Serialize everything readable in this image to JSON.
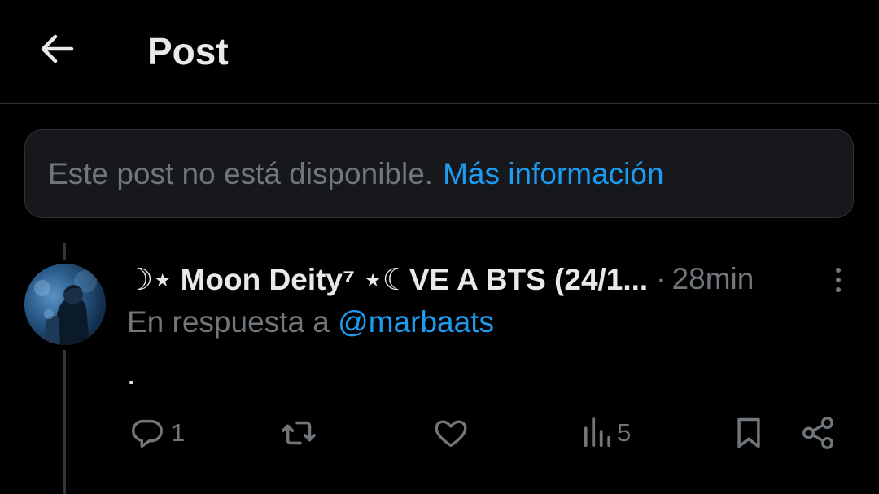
{
  "header": {
    "title": "Post",
    "back_icon": "arrow-left-icon"
  },
  "notice": {
    "text": "Este post no está disponible.",
    "link": "Más información"
  },
  "tweet": {
    "display_name": "☽⋆ Moon Deity⁷ ⋆☾VE A BTS (24/1...",
    "separator": "·",
    "timestamp": "28min",
    "reply_prefix": "En respuesta a",
    "reply_handle": "@marbaats",
    "text": ".",
    "actions": {
      "reply_count": "1",
      "retweet_count": "",
      "like_count": "",
      "views_count": "5"
    }
  },
  "colors": {
    "background": "#000000",
    "text_primary": "#e7e9ea",
    "text_secondary": "#71767b",
    "accent": "#1d9bf0",
    "border": "#2f3336",
    "notice_bg": "#16181c"
  }
}
